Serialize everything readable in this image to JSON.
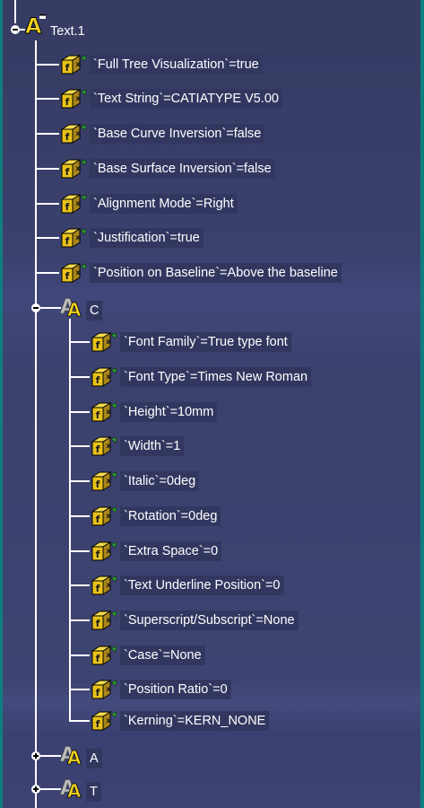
{
  "tree": {
    "root": {
      "label": "Text.1",
      "icon": "text-feature-icon",
      "expanded": true,
      "parameters": [
        "`Full Tree Visualization`=true",
        "`Text String`=CATIATYPE V5.00",
        "`Base Curve Inversion`=false",
        "`Base Surface Inversion`=false",
        "`Alignment Mode`=Right",
        "`Justification`=true",
        "`Position on Baseline`=Above the baseline"
      ],
      "characters": [
        {
          "label": "C",
          "icon": "character-icon",
          "expanded": true,
          "parameters": [
            "`Font Family`=True type font",
            "`Font Type`=Times New Roman",
            "`Height`=10mm",
            "`Width`=1",
            "`Italic`=0deg",
            "`Rotation`=0deg",
            "`Extra Space`=0",
            "`Text Underline Position`=0",
            "`Superscript/Subscript`=None",
            "`Case`=None",
            "`Position Ratio`=0",
            "`Kerning`=KERN_NONE"
          ]
        },
        {
          "label": "A",
          "icon": "character-icon",
          "expanded": false,
          "parameters": []
        },
        {
          "label": "T",
          "icon": "character-icon",
          "expanded": false,
          "parameters": []
        }
      ]
    },
    "colors": {
      "background": "#3b416d",
      "frame": "#0e7f7f",
      "label_box": "#323760",
      "text": "#ffffff",
      "icon_gold": "#e8c21a"
    }
  }
}
